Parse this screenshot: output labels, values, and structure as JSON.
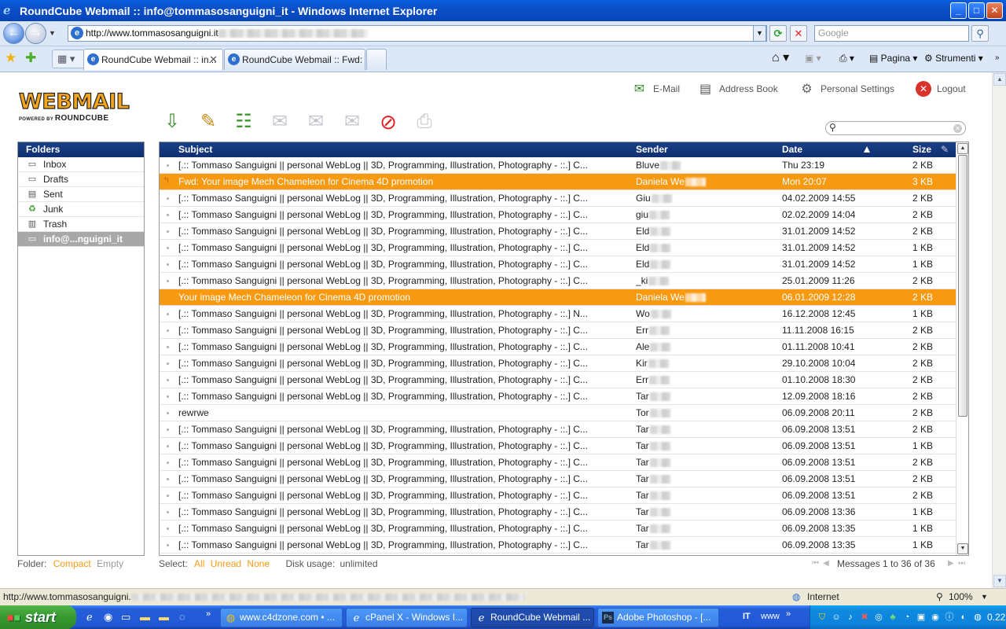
{
  "window": {
    "title": "RoundCube Webmail :: info@tommasosanguigni_it - Windows Internet Explorer",
    "minimize": "_",
    "maximize": "□",
    "close": "✕"
  },
  "address_bar": {
    "url": "http://www.tommasosanguigni.it",
    "search_placeholder": "Google"
  },
  "tabs": [
    {
      "label": "RoundCube Webmail :: in..."
    },
    {
      "label": "RoundCube Webmail :: Fwd: ..."
    }
  ],
  "command_bar": {
    "page_label": "Pagina",
    "tools_label": "Strumenti"
  },
  "app": {
    "logo_text": "WEBMAIL",
    "logo_sub": "POWERED BY",
    "logo_sub_brand": "ROUNDCUBE",
    "top_nav": [
      "E-Mail",
      "Address Book",
      "Personal Settings",
      "Logout"
    ],
    "toolbar_icons": [
      "get-mail-icon",
      "compose-icon",
      "address-book-icon",
      "reply-icon",
      "reply-all-icon",
      "forward-icon",
      "delete-icon",
      "print-icon"
    ],
    "folders_header": "Folders",
    "folders": [
      {
        "name": "Inbox",
        "icon": "inbox-icon"
      },
      {
        "name": "Drafts",
        "icon": "drafts-icon"
      },
      {
        "name": "Sent",
        "icon": "sent-icon"
      },
      {
        "name": "Junk",
        "icon": "junk-icon"
      },
      {
        "name": "Trash",
        "icon": "trash-icon"
      },
      {
        "name": "info@...nguigni_it",
        "icon": "folder-icon",
        "selected": true
      }
    ],
    "list_headers": {
      "subject": "Subject",
      "sender": "Sender",
      "date": "Date",
      "size": "Size"
    },
    "messages": [
      {
        "subject": "[.:: Tommaso Sanguigni || personal WebLog || 3D, Programming, Illustration, Photography - ::.] C...",
        "sender": "Bluve",
        "date": "Thu 23:19",
        "size": "2 KB",
        "highlight": false
      },
      {
        "subject": "Fwd: Your image Mech Chameleon for Cinema 4D promotion",
        "sender": "Daniela We",
        "date": "Mon 20:07",
        "size": "3 KB",
        "highlight": true,
        "replied": true
      },
      {
        "subject": "[.:: Tommaso Sanguigni || personal WebLog || 3D, Programming, Illustration, Photography - ::.] C...",
        "sender": "Giu",
        "date": "04.02.2009 14:55",
        "size": "2 KB",
        "highlight": false
      },
      {
        "subject": "[.:: Tommaso Sanguigni || personal WebLog || 3D, Programming, Illustration, Photography - ::.] C...",
        "sender": "giu",
        "date": "02.02.2009 14:04",
        "size": "2 KB",
        "highlight": false
      },
      {
        "subject": "[.:: Tommaso Sanguigni || personal WebLog || 3D, Programming, Illustration, Photography - ::.] C...",
        "sender": "Eld",
        "date": "31.01.2009 14:52",
        "size": "2 KB",
        "highlight": false
      },
      {
        "subject": "[.:: Tommaso Sanguigni || personal WebLog || 3D, Programming, Illustration, Photography - ::.] C...",
        "sender": "Eld",
        "date": "31.01.2009 14:52",
        "size": "1 KB",
        "highlight": false
      },
      {
        "subject": "[.:: Tommaso Sanguigni || personal WebLog || 3D, Programming, Illustration, Photography - ::.] C...",
        "sender": "Eld",
        "date": "31.01.2009 14:52",
        "size": "1 KB",
        "highlight": false
      },
      {
        "subject": "[.:: Tommaso Sanguigni || personal WebLog || 3D, Programming, Illustration, Photography - ::.] C...",
        "sender": "_ki",
        "date": "25.01.2009 11:26",
        "size": "2 KB",
        "highlight": false
      },
      {
        "subject": "Your image Mech Chameleon for Cinema 4D promotion",
        "sender": "Daniela We",
        "date": "06.01.2009 12:28",
        "size": "2 KB",
        "highlight": true
      },
      {
        "subject": "[.:: Tommaso Sanguigni || personal WebLog || 3D, Programming, Illustration, Photography - ::.] N...",
        "sender": "Wo",
        "date": "16.12.2008 12:45",
        "size": "1 KB",
        "highlight": false
      },
      {
        "subject": "[.:: Tommaso Sanguigni || personal WebLog || 3D, Programming, Illustration, Photography - ::.] C...",
        "sender": "Err",
        "date": "11.11.2008 16:15",
        "size": "2 KB",
        "highlight": false
      },
      {
        "subject": "[.:: Tommaso Sanguigni || personal WebLog || 3D, Programming, Illustration, Photography - ::.] C...",
        "sender": "Ale",
        "date": "01.11.2008 10:41",
        "size": "2 KB",
        "highlight": false
      },
      {
        "subject": "[.:: Tommaso Sanguigni || personal WebLog || 3D, Programming, Illustration, Photography - ::.] C...",
        "sender": "Kir",
        "date": "29.10.2008 10:04",
        "size": "2 KB",
        "highlight": false
      },
      {
        "subject": "[.:: Tommaso Sanguigni || personal WebLog || 3D, Programming, Illustration, Photography - ::.] C...",
        "sender": "Err",
        "date": "01.10.2008 18:30",
        "size": "2 KB",
        "highlight": false
      },
      {
        "subject": "[.:: Tommaso Sanguigni || personal WebLog || 3D, Programming, Illustration, Photography - ::.] C...",
        "sender": "Tar",
        "date": "12.09.2008 18:16",
        "size": "2 KB",
        "highlight": false
      },
      {
        "subject": "rewrwe",
        "sender": "Tor",
        "date": "06.09.2008 20:11",
        "size": "2 KB",
        "highlight": false
      },
      {
        "subject": "[.:: Tommaso Sanguigni || personal WebLog || 3D, Programming, Illustration, Photography - ::.] C...",
        "sender": "Tar",
        "date": "06.09.2008 13:51",
        "size": "2 KB",
        "highlight": false
      },
      {
        "subject": "[.:: Tommaso Sanguigni || personal WebLog || 3D, Programming, Illustration, Photography - ::.] C...",
        "sender": "Tar",
        "date": "06.09.2008 13:51",
        "size": "1 KB",
        "highlight": false
      },
      {
        "subject": "[.:: Tommaso Sanguigni || personal WebLog || 3D, Programming, Illustration, Photography - ::.] C...",
        "sender": "Tar",
        "date": "06.09.2008 13:51",
        "size": "2 KB",
        "highlight": false
      },
      {
        "subject": "[.:: Tommaso Sanguigni || personal WebLog || 3D, Programming, Illustration, Photography - ::.] C...",
        "sender": "Tar",
        "date": "06.09.2008 13:51",
        "size": "2 KB",
        "highlight": false
      },
      {
        "subject": "[.:: Tommaso Sanguigni || personal WebLog || 3D, Programming, Illustration, Photography - ::.] C...",
        "sender": "Tar",
        "date": "06.09.2008 13:51",
        "size": "2 KB",
        "highlight": false
      },
      {
        "subject": "[.:: Tommaso Sanguigni || personal WebLog || 3D, Programming, Illustration, Photography - ::.] C...",
        "sender": "Tar",
        "date": "06.09.2008 13:36",
        "size": "1 KB",
        "highlight": false
      },
      {
        "subject": "[.:: Tommaso Sanguigni || personal WebLog || 3D, Programming, Illustration, Photography - ::.] C...",
        "sender": "Tar",
        "date": "06.09.2008 13:35",
        "size": "1 KB",
        "highlight": false
      },
      {
        "subject": "[.:: Tommaso Sanguigni || personal WebLog || 3D, Programming, Illustration, Photography - ::.] C...",
        "sender": "Tar",
        "date": "06.09.2008 13:35",
        "size": "1 KB",
        "highlight": false
      }
    ],
    "footer": {
      "folder_label": "Folder:",
      "compact": "Compact",
      "empty": "Empty",
      "select_label": "Select:",
      "select_all": "All",
      "select_unread": "Unread",
      "select_none": "None",
      "disk_usage_label": "Disk usage:",
      "disk_usage_value": "unlimited",
      "messages_count": "Messages 1 to 36 of 36"
    }
  },
  "status_bar": {
    "url": "http://www.tommasosanguigni.",
    "zone": "Internet",
    "zoom": "100%"
  },
  "taskbar": {
    "start": "start",
    "tasks": [
      {
        "label": "www.c4dzone.com • ...",
        "active": false
      },
      {
        "label": "cPanel X - Windows I...",
        "active": false
      },
      {
        "label": "RoundCube Webmail ...",
        "active": true
      },
      {
        "label": "Adobe Photoshop - [...",
        "active": false
      }
    ],
    "lang": "IT",
    "www": "www",
    "clock": "0.22"
  },
  "colors": {
    "highlight_row": "#f79a12",
    "header_blue": "#0f2f70",
    "accent_orange": "#f79a12"
  }
}
